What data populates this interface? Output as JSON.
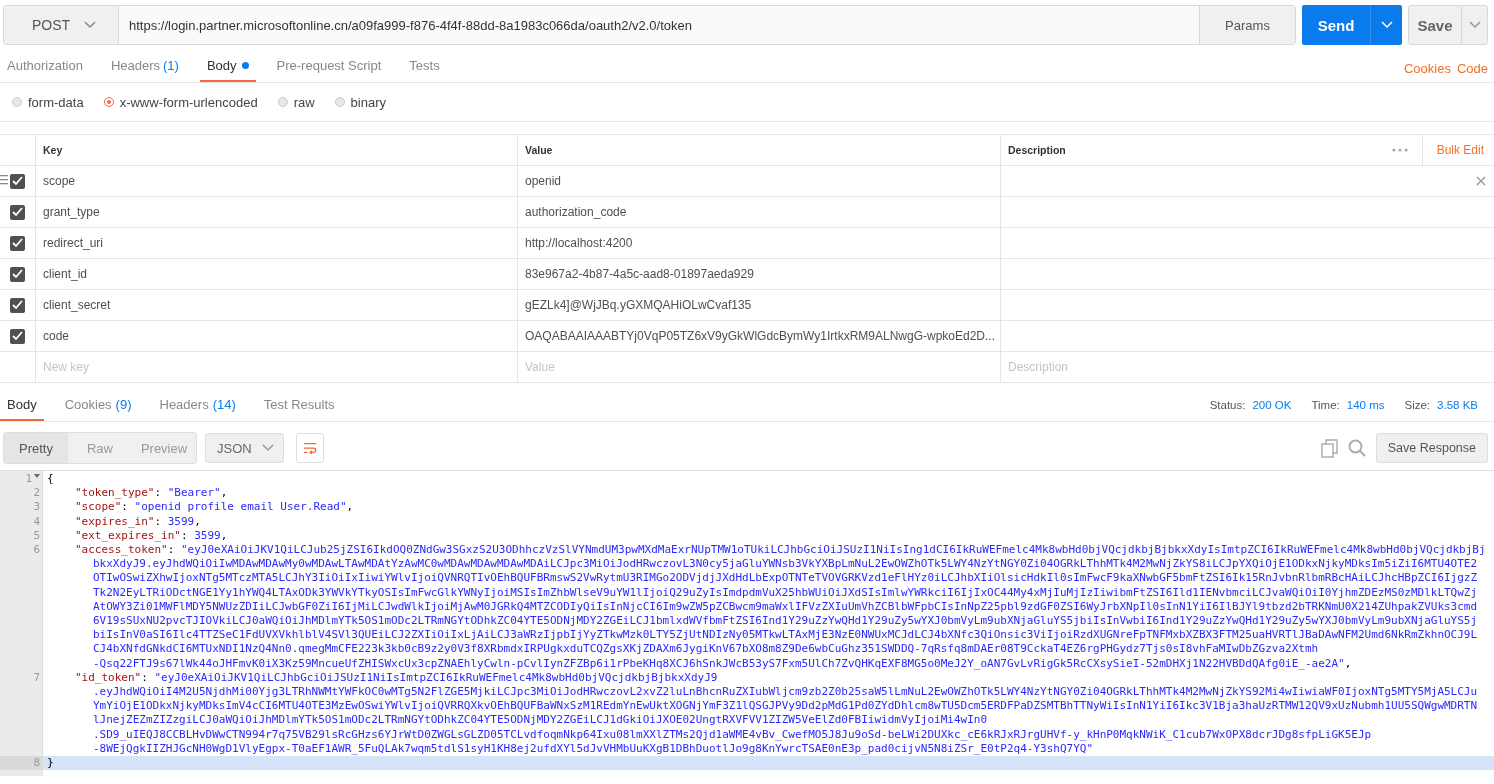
{
  "request": {
    "method": "POST",
    "url": "https://login.partner.microsoftonline.cn/a09fa999-f876-4f4f-88dd-8a1983c066da/oauth2/v2.0/token",
    "params_button": "Params",
    "send_button": "Send",
    "save_button": "Save"
  },
  "request_tabs": [
    {
      "label": "Authorization",
      "selected": false,
      "modified": false
    },
    {
      "label": "Headers",
      "count": "(1)",
      "selected": false,
      "modified": false
    },
    {
      "label": "Body",
      "selected": true,
      "modified": true
    },
    {
      "label": "Pre-request Script",
      "selected": false,
      "modified": false
    },
    {
      "label": "Tests",
      "selected": false,
      "modified": false
    }
  ],
  "request_links": [
    "Cookies",
    "Code"
  ],
  "body_types": [
    {
      "label": "form-data",
      "selected": false
    },
    {
      "label": "x-www-form-urlencoded",
      "selected": true
    },
    {
      "label": "raw",
      "selected": false
    },
    {
      "label": "binary",
      "selected": false
    }
  ],
  "params_table": {
    "columns": [
      "Key",
      "Value",
      "Description"
    ],
    "bulk_edit": "Bulk Edit",
    "rows": [
      {
        "key": "scope",
        "value": "openid",
        "checked": true,
        "hovered": true
      },
      {
        "key": "grant_type",
        "value": "authorization_code",
        "checked": true,
        "hovered": false
      },
      {
        "key": "redirect_uri",
        "value": "http://localhost:4200",
        "checked": true,
        "hovered": false
      },
      {
        "key": "client_id",
        "value": "83e967a2-4b87-4a5c-aad8-01897aeda929",
        "checked": true,
        "hovered": false
      },
      {
        "key": "client_secret",
        "value": "gEZLk4]@WjJBq.yGXMQAHiOLwCvaf135",
        "checked": true,
        "hovered": false
      },
      {
        "key": "code",
        "value": "OAQABAAIAAABTYj0VqP05TZ6xV9yGkWlGdcBymWy1IrtkxRM9ALNwgG-wpkoEd2D...",
        "checked": true,
        "hovered": false
      }
    ],
    "new_row": {
      "key": "New key",
      "value": "Value",
      "description": "Description"
    }
  },
  "response_tabs": [
    {
      "label": "Body",
      "selected": true
    },
    {
      "label": "Cookies",
      "count": "(9)",
      "selected": false
    },
    {
      "label": "Headers",
      "count": "(14)",
      "selected": false
    },
    {
      "label": "Test Results",
      "selected": false
    }
  ],
  "response_meta": [
    {
      "label": "Status:",
      "value": "200 OK"
    },
    {
      "label": "Time:",
      "value": "140 ms"
    },
    {
      "label": "Size:",
      "value": "3.58 KB"
    }
  ],
  "view_modes": [
    {
      "label": "Pretty",
      "selected": true
    },
    {
      "label": "Raw",
      "selected": false
    },
    {
      "label": "Preview",
      "selected": false
    }
  ],
  "format": "JSON",
  "save_response": "Save Response",
  "code_lines": [
    {
      "number": "1",
      "active": false,
      "foldable": true,
      "segments": [
        [
          {
            "kind": "punct",
            "text": "{"
          }
        ]
      ]
    },
    {
      "number": "2",
      "active": false,
      "foldable": false,
      "segments": [
        [
          {
            "kind": "key",
            "text": "\"token_type\""
          },
          {
            "kind": "punct",
            "text": ": "
          },
          {
            "kind": "string",
            "text": "\"Bearer\""
          },
          {
            "kind": "punct",
            "text": ","
          }
        ]
      ]
    },
    {
      "number": "3",
      "active": false,
      "foldable": false,
      "segments": [
        [
          {
            "kind": "key",
            "text": "\"scope\""
          },
          {
            "kind": "punct",
            "text": ": "
          },
          {
            "kind": "string",
            "text": "\"openid profile email User.Read\""
          },
          {
            "kind": "punct",
            "text": ","
          }
        ]
      ]
    },
    {
      "number": "4",
      "active": false,
      "foldable": false,
      "segments": [
        [
          {
            "kind": "key",
            "text": "\"expires_in\""
          },
          {
            "kind": "punct",
            "text": ": "
          },
          {
            "kind": "number",
            "text": "3599"
          },
          {
            "kind": "punct",
            "text": ","
          }
        ]
      ]
    },
    {
      "number": "5",
      "active": false,
      "foldable": false,
      "segments": [
        [
          {
            "kind": "key",
            "text": "\"ext_expires_in\""
          },
          {
            "kind": "punct",
            "text": ": "
          },
          {
            "kind": "number",
            "text": "3599"
          },
          {
            "kind": "punct",
            "text": ","
          }
        ]
      ]
    },
    {
      "number": "6",
      "active": false,
      "foldable": false,
      "segments": [
        [
          {
            "kind": "key",
            "text": "\"access_token\""
          },
          {
            "kind": "punct",
            "text": ": "
          },
          {
            "kind": "string",
            "text": "\"eyJ0eXAiOiJKV1QiLCJub25jZSI6IkdOQ0ZNdGw3SGxzS2U3ODhhczVzSlVYNmdUM3pwMXdMaExrNUpTMW1oTUkiLCJhbGciOiJSUzI1NiIsIng1dCI6IkRuWEFmelc4Mk8wbHd0bjVQcjdkbjBjbkxXdyIsImtpZCI6IkRuWEFmelc4Mk8wbHd0bjVQcjdkbjBj"
          }
        ],
        [
          {
            "kind": "string",
            "text": "bkxXdyJ9.eyJhdWQiOiIwMDAwMDAwMy0wMDAwLTAwMDAtYzAwMC0wMDAwMDAwMDAwMDAiLCJpc3MiOiJodHRwczovL3N0cy5jaGluYWNsb3VkYXBpLmNuL2EwOWZhOTk5LWY4NzYtNGY0Zi04OGRkLThhMTk4M2MwNjZkYS8iLCJpYXQiOjE1ODkxNjkyMDksIm5iZiI6MTU4OTE2"
          }
        ],
        [
          {
            "kind": "string",
            "text": "OTIwOSwiZXhwIjoxNTg5MTczMTA5LCJhY3IiOiIxIiwiYWlvIjoiQVNRQTIvOEhBQUFBRmswS2VwRytmU3RIMGo2ODVjdjJXdHdLbExpOTNTeTVOVGRKVzd1eFlHYz0iLCJhbXIiOlsicHdkIl0sImFwcF9kaXNwbGF5bmFtZSI6Ik15RnJvbnRlbmRBcHAiLCJhcHBpZCI6IjgzZ"
          }
        ],
        [
          {
            "kind": "string",
            "text": "Tk2N2EyLTRiODctNGE1Yy1hYWQ4LTAxODk3YWVkYTkyOSIsImFwcGlkYWNyIjoiMSIsImZhbWlseV9uYW1lIjoiQ29uZyIsImdpdmVuX25hbWUiOiJXdSIsImlwYWRkciI6IjIxOC44My4xMjIuMjIzIiwibmFtZSI6Ild1IENvbmciLCJvaWQiOiI0YjhmZDEzMS0zMDlkLTQwZj"
          }
        ],
        [
          {
            "kind": "string",
            "text": "AtOWY3Zi01MWFlMDY5NWUzZDIiLCJwbGF0ZiI6IjMiLCJwdWlkIjoiMjAwM0JGRkQ4MTZCODIyQiIsInNjcCI6Im9wZW5pZCBwcm9maWxlIFVzZXIuUmVhZCBlbWFpbCIsInNpZ25pbl9zdGF0ZSI6WyJrbXNpIl0sInN1YiI6IlBJYl9tbzd2bTRKNmU0X214ZUhpakZVUks3cmd"
          }
        ],
        [
          {
            "kind": "string",
            "text": "6V19sSUxNU2pvcTJIOVkiLCJ0aWQiOiJhMDlmYTk5OS1mODc2LTRmNGYtODhkZC04YTE5ODNjMDY2ZGEiLCJ1bmlxdWVfbmFtZSI6Ind1Y29uZzYwQHd1Y29uZy5wYXJ0bmVyLm9ubXNjaGluYS5jbiIsInVwbiI6Ind1Y29uZzYwQHd1Y29uZy5wYXJ0bmVyLm9ubXNjaGluYS5j"
          }
        ],
        [
          {
            "kind": "string",
            "text": "biIsInV0aSI6Ilc4TTZSeC1FdUVXVkhlblV4SVl3QUEiLCJ2ZXIiOiIxLjAiLCJ3aWRzIjpbIjYyZTkwMzk0LTY5ZjUtNDIzNy05MTkwLTAxMjE3NzE0NWUxMCJdLCJ4bXNfc3QiOnsic3ViIjoiRzdXUGNreFpTNFMxbXZBX3FTM25uaHVRTlJBaDAwNFM2Umd6NkRmZkhnOCJ9L"
          }
        ],
        [
          {
            "kind": "string",
            "text": "CJ4bXNfdGNkdCI6MTUxNDI1NzQ4Nn0.qmegMmCFE223k3kb0cB9z2y0V3f8XRbmdxIRPUgkxduTCQZgsXKjZDAXm6JygiKnV67bXO8m8Z9De6wbCuGhz351SWDDQ-7qRsfq8mDAEr08T9CckaT4EZ6rgPHGydz7Tjs0sI8vhFaMIwDbZGzva2Xtmh"
          }
        ],
        [
          {
            "kind": "string",
            "text": "-Qsq22FTJ9s67lWk44oJHFmvK0iX3Kz59MncueUfZHISWxcUx3cpZNAEhlyCwln-pCvlIynZFZBp6i1rPbeKHq8XCJ6hSnkJWcB53yS7Fxm5UlCh7ZvQHKqEXF8MG5o0MeJ2Y_oAN7GvLvRigGk5RcCXsySieI-52mDHXj1N22HVBDdQAfg0iE_-ae2A\""
          },
          {
            "kind": "punct",
            "text": ","
          }
        ]
      ]
    },
    {
      "number": "7",
      "active": false,
      "foldable": false,
      "segments": [
        [
          {
            "kind": "key",
            "text": "\"id_token\""
          },
          {
            "kind": "punct",
            "text": ": "
          },
          {
            "kind": "string",
            "text": "\"eyJ0eXAiOiJKV1QiLCJhbGciOiJSUzI1NiIsImtpZCI6IkRuWEFmelc4Mk8wbHd0bjVQcjdkbjBjbkxXdyJ9"
          }
        ],
        [
          {
            "kind": "string",
            "text": ".eyJhdWQiOiI4M2U5NjdhMi00Yjg3LTRhNWMtYWFkOC0wMTg5N2FlZGE5MjkiLCJpc3MiOiJodHRwczovL2xvZ2luLnBhcnRuZXIubWljcm9zb2Z0b25saW5lLmNuL2EwOWZhOTk5LWY4NzYtNGY0Zi04OGRkLThhMTk4M2MwNjZkYS92Mi4wIiwiaWF0IjoxNTg5MTY5MjA5LCJu"
          }
        ],
        [
          {
            "kind": "string",
            "text": "YmYiOjE1ODkxNjkyMDksImV4cCI6MTU4OTE3MzEwOSwiYWlvIjoiQVRRQXkvOEhBQUFBaWNxSzM1REdmYnEwUktXOGNjYmF3Z1lQSGJPVy9Dd2pMdG1Pd0ZYdDhlcm8wTU5Dcm5ERDFPaDZSMTBhTTNyWiIsInN1YiI6Ikc3V1Bja3haUzRTMW12QV9xUzNubmh1UU5SQWgwMDRTN"
          }
        ],
        [
          {
            "kind": "string",
            "text": "lJnejZEZmZIZzgiLCJ0aWQiOiJhMDlmYTk5OS1mODc2LTRmNGYtODhkZC04YTE5ODNjMDY2ZGEiLCJ1dGkiOiJXOE02UngtRXVFVV1ZIZW5VeElZd0FBIiwidmVyIjoiMi4wIn0"
          }
        ],
        [
          {
            "kind": "string",
            "text": ".SD9_uIEQJ8CCBLHvDWwCTN994r7q75VB29lsRcGHzs6YJrWtD0ZWGLsGLZD05TCLvdfoqmNkp64Ixu08lmXXlZTMs2Qjd1aWME4vBv_CwefMO5J8Ju9oSd-beLWi2DUXkc_cE6kRJxRJrgUHVf-y_kHnP0MqkNWiK_C1cub7WxOPX8dcrJDg8sfpLiGK5EJp"
          }
        ],
        [
          {
            "kind": "string",
            "text": "-8WEjQgkIIZHJGcNH0WgD1VlyEgpx-T0aEF1AWR_5FuQLAk7wqm5tdlS1syH1KH8ej2ufdXYl5dJvVHMbUuKXgB1DBhDuotlJo9g8KnYwrcTSAE0nE3p_pad0cijvN5N8iZSr_E0tP2q4-Y3shQ7YQ\""
          }
        ]
      ]
    },
    {
      "number": "8",
      "active": true,
      "foldable": false,
      "segments": [
        [
          {
            "kind": "punct",
            "text": "}"
          }
        ]
      ]
    }
  ]
}
